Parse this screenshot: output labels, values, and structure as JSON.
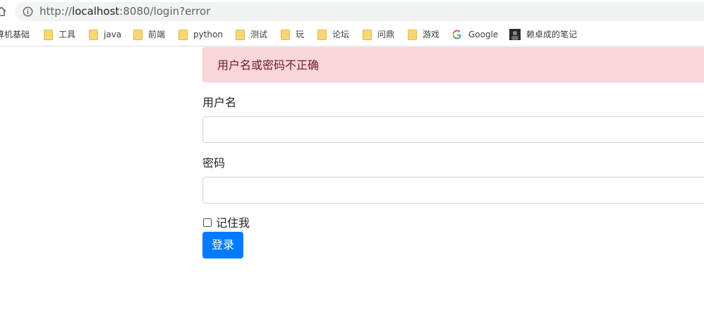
{
  "browser": {
    "url_prefix": "http://",
    "url_host": "localhost",
    "url_rest": ":8080/login?error"
  },
  "bookmarks": {
    "truncated_first": "算机基础",
    "items": [
      {
        "label": "工具",
        "icon": "folder-icon"
      },
      {
        "label": "java",
        "icon": "folder-icon"
      },
      {
        "label": "前端",
        "icon": "folder-icon"
      },
      {
        "label": "python",
        "icon": "folder-icon"
      },
      {
        "label": "测试",
        "icon": "folder-icon"
      },
      {
        "label": "玩",
        "icon": "folder-icon"
      },
      {
        "label": "论坛",
        "icon": "folder-icon"
      },
      {
        "label": "问鼎",
        "icon": "folder-icon"
      },
      {
        "label": "游戏",
        "icon": "folder-icon"
      },
      {
        "label": "Google",
        "icon": "google-icon"
      },
      {
        "label": "赖卓成的笔记",
        "icon": "avatar-icon"
      }
    ]
  },
  "login": {
    "error_message": "用户名或密码不正确",
    "username_label": "用户名",
    "username_value": "",
    "password_label": "密码",
    "password_value": "",
    "remember_label": "记住我",
    "remember_checked": false,
    "submit_label": "登录"
  },
  "colors": {
    "alert_bg": "#f8d7da",
    "alert_text": "#721c24",
    "primary": "#007bff",
    "folder": "#f7d774"
  }
}
